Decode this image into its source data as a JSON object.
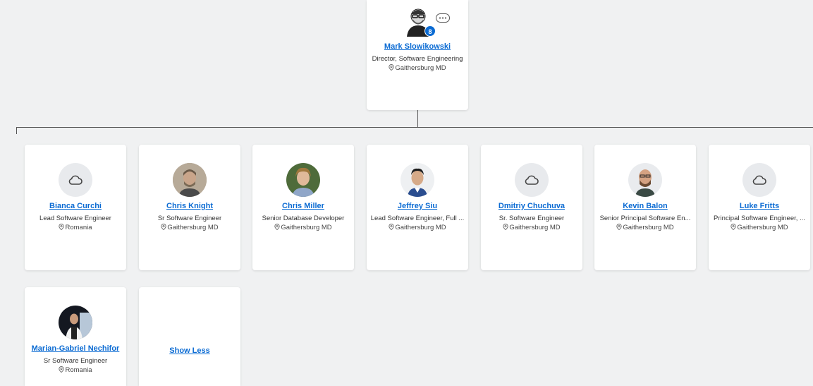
{
  "manager": {
    "name": "Mark Slowikowski",
    "title": "Director, Software Engineering",
    "location": "Gaithersburg MD",
    "report_count": "8",
    "avatar_icon": "person-photo",
    "more_icon": "more-options-icon"
  },
  "reports": [
    {
      "name": "Bianca Curchi",
      "title": "Lead Software Engineer",
      "location": "Romania",
      "avatar": "cloud-icon"
    },
    {
      "name": "Chris Knight",
      "title": "Sr Software Engineer",
      "location": "Gaithersburg MD",
      "avatar": "photo"
    },
    {
      "name": "Chris Miller",
      "title": "Senior Database Developer",
      "location": "Gaithersburg MD",
      "avatar": "photo"
    },
    {
      "name": "Jeffrey Siu",
      "title": "Lead Software Engineer, Full ...",
      "location": "Gaithersburg MD",
      "avatar": "photo"
    },
    {
      "name": "Dmitriy Chuchuva",
      "title": "Sr. Software Engineer",
      "location": "Gaithersburg MD",
      "avatar": "cloud-icon"
    },
    {
      "name": "Kevin Balon",
      "title": "Senior Principal Software En...",
      "location": "Gaithersburg MD",
      "avatar": "photo"
    },
    {
      "name": "Luke Fritts",
      "title": "Principal Software Engineer, ...",
      "location": "Gaithersburg MD",
      "avatar": "cloud-icon"
    },
    {
      "name": "Marian-Gabriel Nechifor",
      "title": "Sr Software Engineer",
      "location": "Romania",
      "avatar": "photo"
    }
  ],
  "show_less_label": "Show Less",
  "colors": {
    "link": "#0b6bd3",
    "badge": "#0b6bd3",
    "background": "#f0f1f2"
  }
}
